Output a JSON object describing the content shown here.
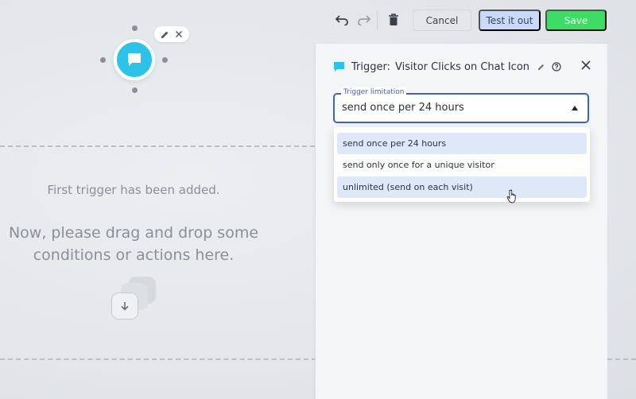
{
  "toolbar": {
    "undo_icon": "undo-icon",
    "redo_icon": "redo-icon",
    "delete_icon": "trash-icon",
    "cancel_label": "Cancel",
    "test_label": "Test it out",
    "save_label": "Save"
  },
  "canvas": {
    "node_icon": "chat-bubble-icon",
    "node_tools": [
      "pencil-icon",
      "close-icon"
    ],
    "message_small": "First trigger has been added.",
    "message_big_line1": "Now, please drag and drop some",
    "message_big_line2": "conditions or actions here.",
    "drop_icon": "arrow-down-icon"
  },
  "panel": {
    "title_prefix": "Trigger:",
    "title": "Visitor Clicks on Chat Icon",
    "trigger_limitation": {
      "label": "Trigger limitation",
      "value": "send once per 24 hours",
      "options": [
        "send once per 24 hours",
        "send only once for a unique visitor",
        "unlimited (send on each visit)"
      ]
    }
  },
  "colors": {
    "accent_blue": "#3b5fd6",
    "node_cyan": "#2bc3e8",
    "save_green": "#3edc65",
    "test_blue": "#c9d9f6"
  }
}
